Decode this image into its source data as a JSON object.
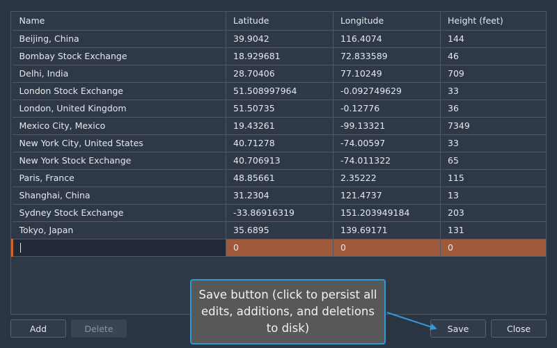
{
  "table": {
    "columns": [
      "Name",
      "Latitude",
      "Longitude",
      "Height (feet)"
    ],
    "rows": [
      [
        "Beijing, China",
        "39.9042",
        "116.4074",
        "144"
      ],
      [
        "Bombay Stock Exchange",
        "18.929681",
        "72.833589",
        "46"
      ],
      [
        "Delhi, India",
        "28.70406",
        "77.10249",
        "709"
      ],
      [
        "London Stock Exchange",
        "51.508997964",
        "-0.092749629",
        "33"
      ],
      [
        "London, United Kingdom",
        "51.50735",
        "-0.12776",
        "36"
      ],
      [
        "Mexico City, Mexico",
        "19.43261",
        "-99.13321",
        "7349"
      ],
      [
        "New York City, United States",
        "40.71278",
        "-74.00597",
        "33"
      ],
      [
        "New York Stock Exchange",
        "40.706913",
        "-74.011322",
        "65"
      ],
      [
        "Paris, France",
        "48.85661",
        "2.35222",
        "115"
      ],
      [
        "Shanghai, China",
        "31.2304",
        "121.4737",
        "13"
      ],
      [
        "Sydney Stock Exchange",
        "-33.86916319",
        "151.203949184",
        "203"
      ],
      [
        "Tokyo, Japan",
        "35.6895",
        "139.69171",
        "131"
      ]
    ],
    "new_row": {
      "name": "",
      "latitude": "0",
      "longitude": "0",
      "height": "0"
    }
  },
  "buttons": {
    "add": "Add",
    "delete": "Delete",
    "save": "Save",
    "close": "Close"
  },
  "tooltip": {
    "text": "Save button (click to persist all edits, additions, and deletions to disk)"
  },
  "colors": {
    "background": "#2b3442",
    "new_row": "#a0593a",
    "edit_accent": "#d4622a",
    "tooltip_border": "#2f9ad6"
  }
}
